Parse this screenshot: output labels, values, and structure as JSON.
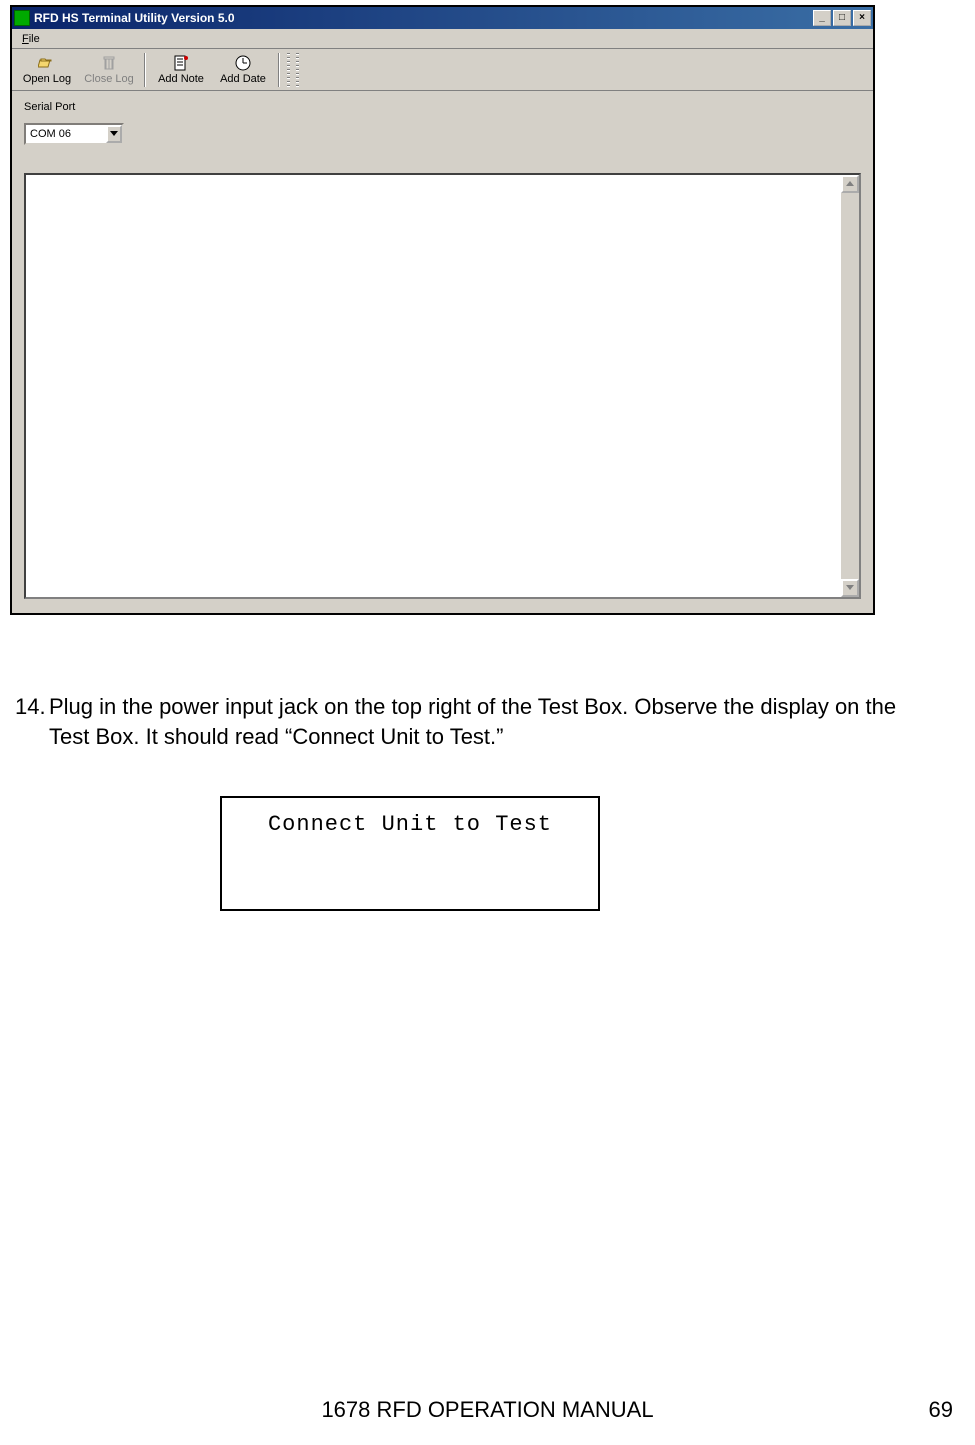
{
  "window": {
    "title": "RFD HS Terminal Utility Version 5.0",
    "controls": {
      "minimize": "_",
      "maximize": "□",
      "close": "×"
    }
  },
  "menu": {
    "file": "File"
  },
  "toolbar": {
    "open_log": "Open Log",
    "close_log": "Close Log",
    "add_note": "Add Note",
    "add_date": "Add Date"
  },
  "serial": {
    "label": "Serial Port",
    "value": "COM 06"
  },
  "log": {
    "content": ""
  },
  "instruction": {
    "number": "14.",
    "text": "Plug in the power input jack on the top right of the Test Box.  Observe the display on the Test Box.  It should read “Connect Unit to Test.”"
  },
  "displaybox": {
    "text": "Connect Unit to Test"
  },
  "footer": {
    "title": "1678 RFD OPERATION MANUAL",
    "page": "69"
  }
}
